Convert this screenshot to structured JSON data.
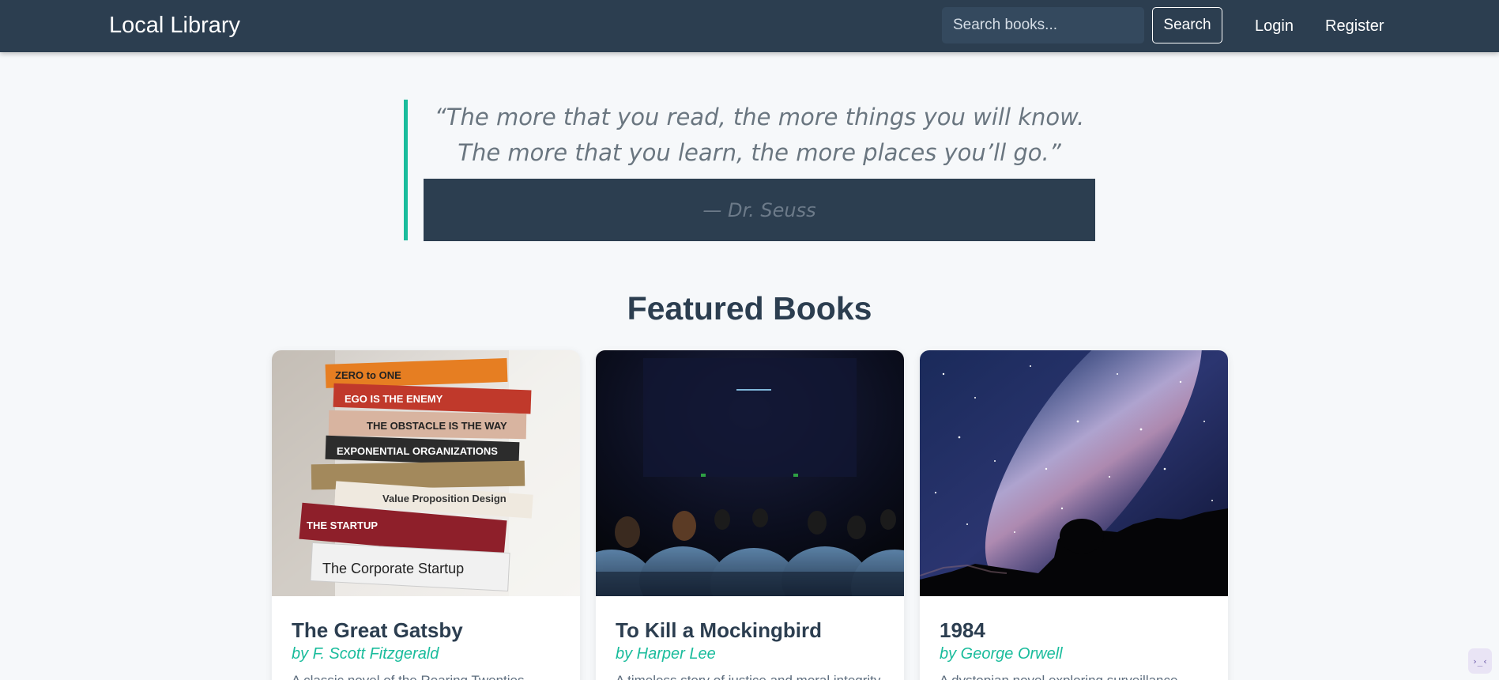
{
  "navbar": {
    "brand": "Local Library",
    "search_placeholder": "Search books...",
    "search_button": "Search",
    "login": "Login",
    "register": "Register"
  },
  "quote": {
    "text": "“The more that you read, the more things you will know. The more that you learn, the more places you’ll go.”",
    "author": "— Dr. Seuss"
  },
  "featured": {
    "title": "Featured Books",
    "books": [
      {
        "title": "The Great Gatsby",
        "author": "by F. Scott Fitzgerald",
        "description": "A classic novel of the Roaring Twenties",
        "image": "stack-of-books-photo"
      },
      {
        "title": "To Kill a Mockingbird",
        "author": "by Harper Lee",
        "description": "A timeless story of justice and moral integrity",
        "image": "movie-theater-audience-photo"
      },
      {
        "title": "1984",
        "author": "by George Orwell",
        "description": "A dystopian novel exploring surveillance",
        "image": "milky-way-night-sky-photo"
      }
    ]
  },
  "corner_widget": {
    "label": "›_‹"
  },
  "colors": {
    "navbar_bg": "#2c3e50",
    "accent": "#1abc9c",
    "page_bg": "#f6f8fa"
  }
}
